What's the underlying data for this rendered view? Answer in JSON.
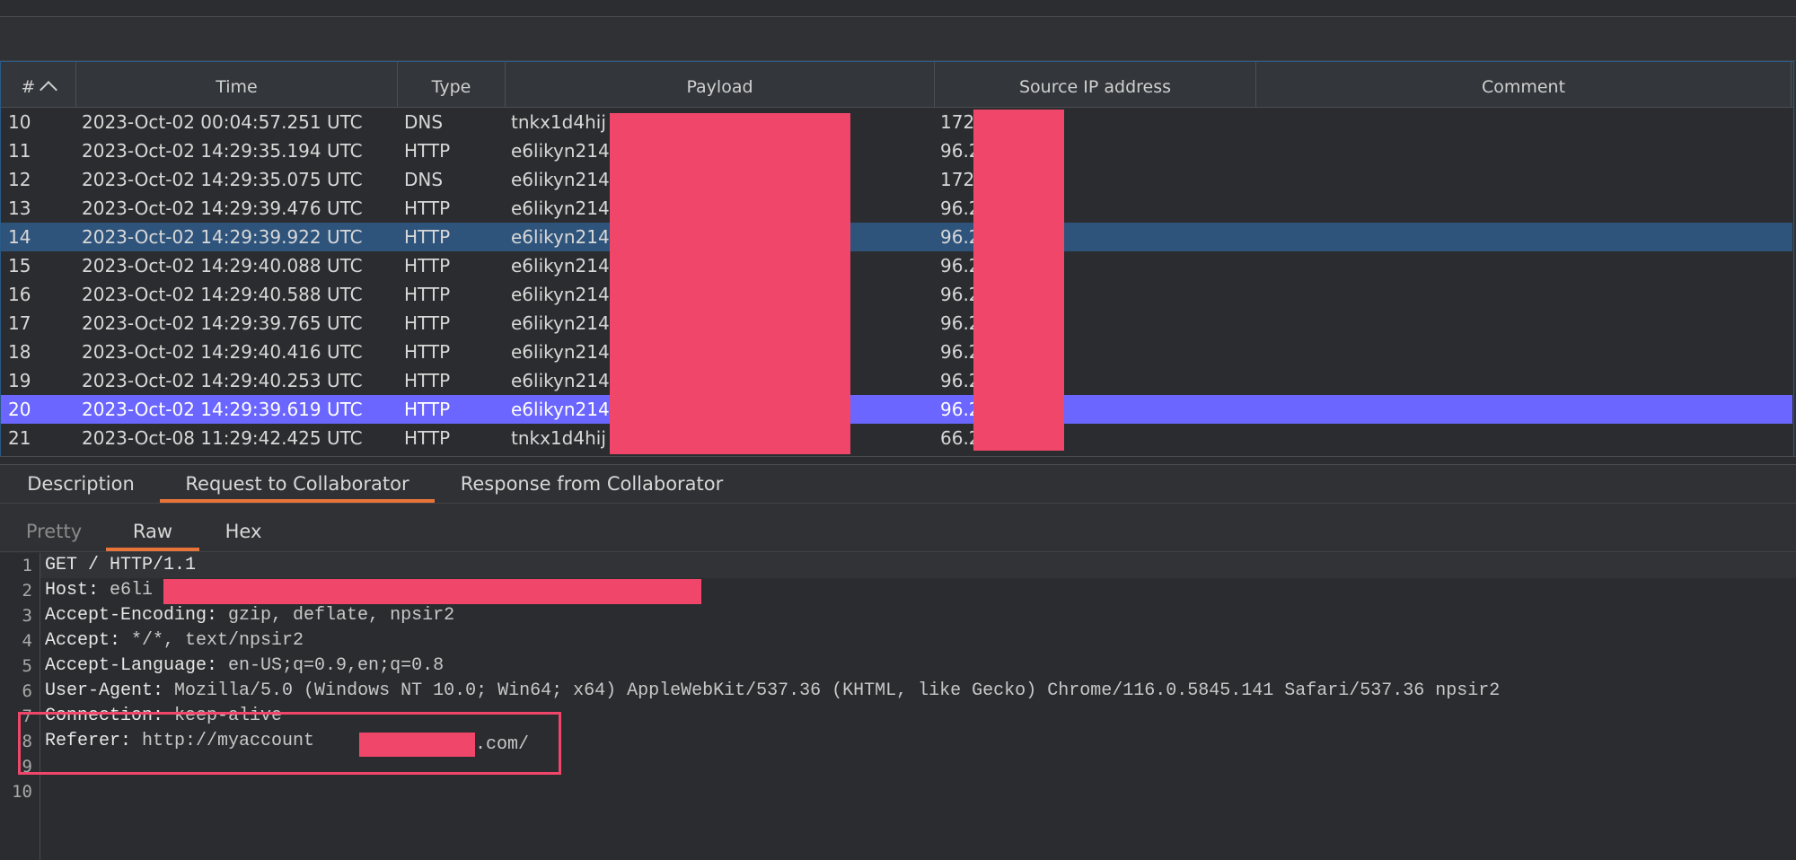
{
  "table": {
    "columns": [
      "#",
      "Time",
      "Type",
      "Payload",
      "Source IP address",
      "Comment"
    ],
    "rows": [
      {
        "num": "10",
        "time": "2023-Oct-02 00:04:57.251 UTC",
        "type": "DNS",
        "payload": "tnkx1d4hij",
        "ip": "172."
      },
      {
        "num": "11",
        "time": "2023-Oct-02 14:29:35.194 UTC",
        "type": "HTTP",
        "payload": "e6likyn214",
        "ip": "96.2"
      },
      {
        "num": "12",
        "time": "2023-Oct-02 14:29:35.075 UTC",
        "type": "DNS",
        "payload": "e6likyn214",
        "ip": "172."
      },
      {
        "num": "13",
        "time": "2023-Oct-02 14:29:39.476 UTC",
        "type": "HTTP",
        "payload": "e6likyn214",
        "ip": "96.2"
      },
      {
        "num": "14",
        "time": "2023-Oct-02 14:29:39.922 UTC",
        "type": "HTTP",
        "payload": "e6likyn214",
        "ip": "96.2"
      },
      {
        "num": "15",
        "time": "2023-Oct-02 14:29:40.088 UTC",
        "type": "HTTP",
        "payload": "e6likyn214",
        "ip": "96.2"
      },
      {
        "num": "16",
        "time": "2023-Oct-02 14:29:40.588 UTC",
        "type": "HTTP",
        "payload": "e6likyn214",
        "ip": "96.2"
      },
      {
        "num": "17",
        "time": "2023-Oct-02 14:29:39.765 UTC",
        "type": "HTTP",
        "payload": "e6likyn214",
        "ip": "96.2"
      },
      {
        "num": "18",
        "time": "2023-Oct-02 14:29:40.416 UTC",
        "type": "HTTP",
        "payload": "e6likyn214",
        "ip": "96.2"
      },
      {
        "num": "19",
        "time": "2023-Oct-02 14:29:40.253 UTC",
        "type": "HTTP",
        "payload": "e6likyn214",
        "ip": "96.2"
      },
      {
        "num": "20",
        "time": "2023-Oct-02 14:29:39.619 UTC",
        "type": "HTTP",
        "payload": "e6likyn214",
        "ip": "96.2"
      },
      {
        "num": "21",
        "time": "2023-Oct-08 11:29:42.425 UTC",
        "type": "HTTP",
        "payload": "tnkx1d4hij",
        "ip": "66.2"
      }
    ]
  },
  "tabs_top": [
    "Description",
    "Request to Collaborator",
    "Response from Collaborator"
  ],
  "tabs_view": [
    "Pretty",
    "Raw",
    "Hex"
  ],
  "editor": {
    "lines": [
      {
        "n": "1",
        "key": "GET / HTTP/1.1",
        "val": ""
      },
      {
        "n": "2",
        "key": "Host:",
        "val": " e6li"
      },
      {
        "n": "3",
        "key": "Accept-Encoding:",
        "val": " gzip, deflate, npsir2"
      },
      {
        "n": "4",
        "key": "Accept:",
        "val": " */*, text/npsir2"
      },
      {
        "n": "5",
        "key": "Accept-Language:",
        "val": " en-US;q=0.9,en;q=0.8"
      },
      {
        "n": "6",
        "key": "User-Agent:",
        "val": " Mozilla/5.0 (Windows NT 10.0; Win64; x64) AppleWebKit/537.36 (KHTML, like Gecko) Chrome/116.0.5845.141 Safari/537.36 npsir2"
      },
      {
        "n": "7",
        "key": "Connection:",
        "val": " keep-alive"
      },
      {
        "n": "8",
        "key": "Referer:",
        "val": " http://myaccount"
      },
      {
        "n": "9",
        "key": "",
        "val": ""
      },
      {
        "n": "10",
        "key": "",
        "val": ""
      }
    ],
    "referer_suffix": ".com/"
  },
  "colors": {
    "selected_row": "#2f547c",
    "highlighted_row": "#6b66ff",
    "redaction": "#f0466a",
    "tab_accent": "#e8743a"
  }
}
